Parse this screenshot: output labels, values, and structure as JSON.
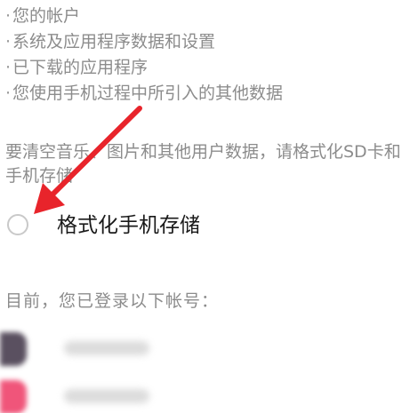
{
  "data_items": [
    {
      "bullet": "·",
      "label": "您的帐户"
    },
    {
      "bullet": "·",
      "label": "系统及应用程序数据和设置"
    },
    {
      "bullet": "·",
      "label": "已下载的应用程序"
    },
    {
      "bullet": "·",
      "label": "您使用手机过程中所引入的其他数据"
    }
  ],
  "note": "要清空音乐、图片和其他用户数据，请格式化SD卡和手机存储",
  "format_option": {
    "label": "格式化手机存储",
    "checked": false
  },
  "accounts": {
    "heading": "目前，您已登录以下帐号：",
    "items": [
      {
        "icon": "account-icon",
        "avatar_color": "#5a5060"
      },
      {
        "icon": "account-icon",
        "avatar_color": "#f0557a"
      }
    ]
  },
  "annotation": {
    "icon": "red-arrow-icon",
    "color": "#e8242b"
  }
}
